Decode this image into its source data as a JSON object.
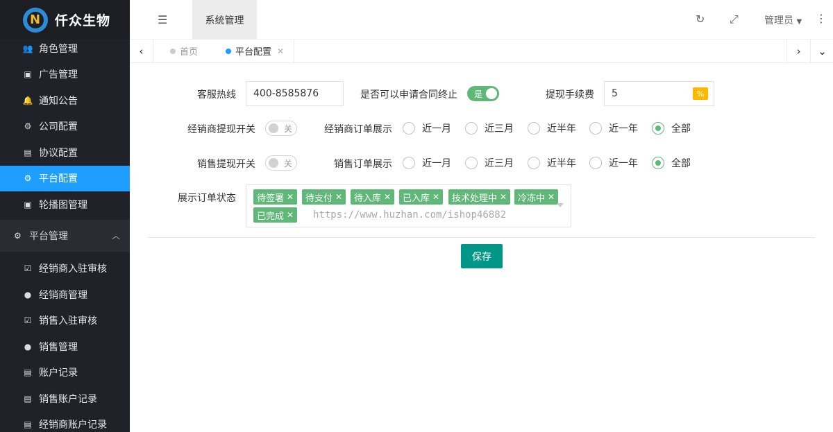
{
  "brand": {
    "name": "仟众生物",
    "logo_letter": "N"
  },
  "sidebar": {
    "items_top": [
      {
        "label": "角色管理",
        "icon": "users-icon"
      },
      {
        "label": "广告管理",
        "icon": "image-icon"
      },
      {
        "label": "通知公告",
        "icon": "bell-icon"
      },
      {
        "label": "公司配置",
        "icon": "cogs-icon"
      },
      {
        "label": "协议配置",
        "icon": "file-icon"
      },
      {
        "label": "平台配置",
        "icon": "gear-icon",
        "active": true
      },
      {
        "label": "轮播图管理",
        "icon": "image-icon"
      }
    ],
    "group": {
      "label": "平台管理",
      "icon": "cogs-icon"
    },
    "items_group": [
      {
        "label": "经销商入驻审核",
        "icon": "check-square-icon"
      },
      {
        "label": "经销商管理",
        "icon": "user-icon"
      },
      {
        "label": "销售入驻审核",
        "icon": "check-square-icon"
      },
      {
        "label": "销售管理",
        "icon": "user-icon"
      },
      {
        "label": "账户记录",
        "icon": "file-icon"
      },
      {
        "label": "销售账户记录",
        "icon": "file-icon"
      },
      {
        "label": "经销商账户记录",
        "icon": "file-icon"
      }
    ]
  },
  "header": {
    "tab": "系统管理",
    "user": "管理员"
  },
  "tabs": {
    "home": "首页",
    "current": "平台配置"
  },
  "form": {
    "hotline_label": "客服热线",
    "hotline_value": "400-8585876",
    "contract_label": "是否可以申请合同终止",
    "contract_switch": "是",
    "fee_label": "提现手续费",
    "fee_value": "5",
    "fee_unit": "%",
    "dealer_withdraw_label": "经销商提现开关",
    "dealer_withdraw_switch": "关",
    "dealer_order_label": "经销商订单展示",
    "sales_withdraw_label": "销售提现开关",
    "sales_withdraw_switch": "关",
    "sales_order_label": "销售订单展示",
    "range_options": [
      "近一月",
      "近三月",
      "近半年",
      "近一年",
      "全部"
    ],
    "selected_range": "全部",
    "status_label": "展示订单状态",
    "status_tags": [
      "待签署",
      "待支付",
      "待入库",
      "已入库",
      "技术处理中",
      "冷冻中",
      "已完成"
    ],
    "watermark": "https://www.huzhan.com/ishop46882",
    "save_label": "保存"
  },
  "colors": {
    "sidebar_bg": "#20222a",
    "active": "#1e9fff",
    "green": "#5fb878",
    "save": "#009688",
    "percent": "#ffb800"
  }
}
